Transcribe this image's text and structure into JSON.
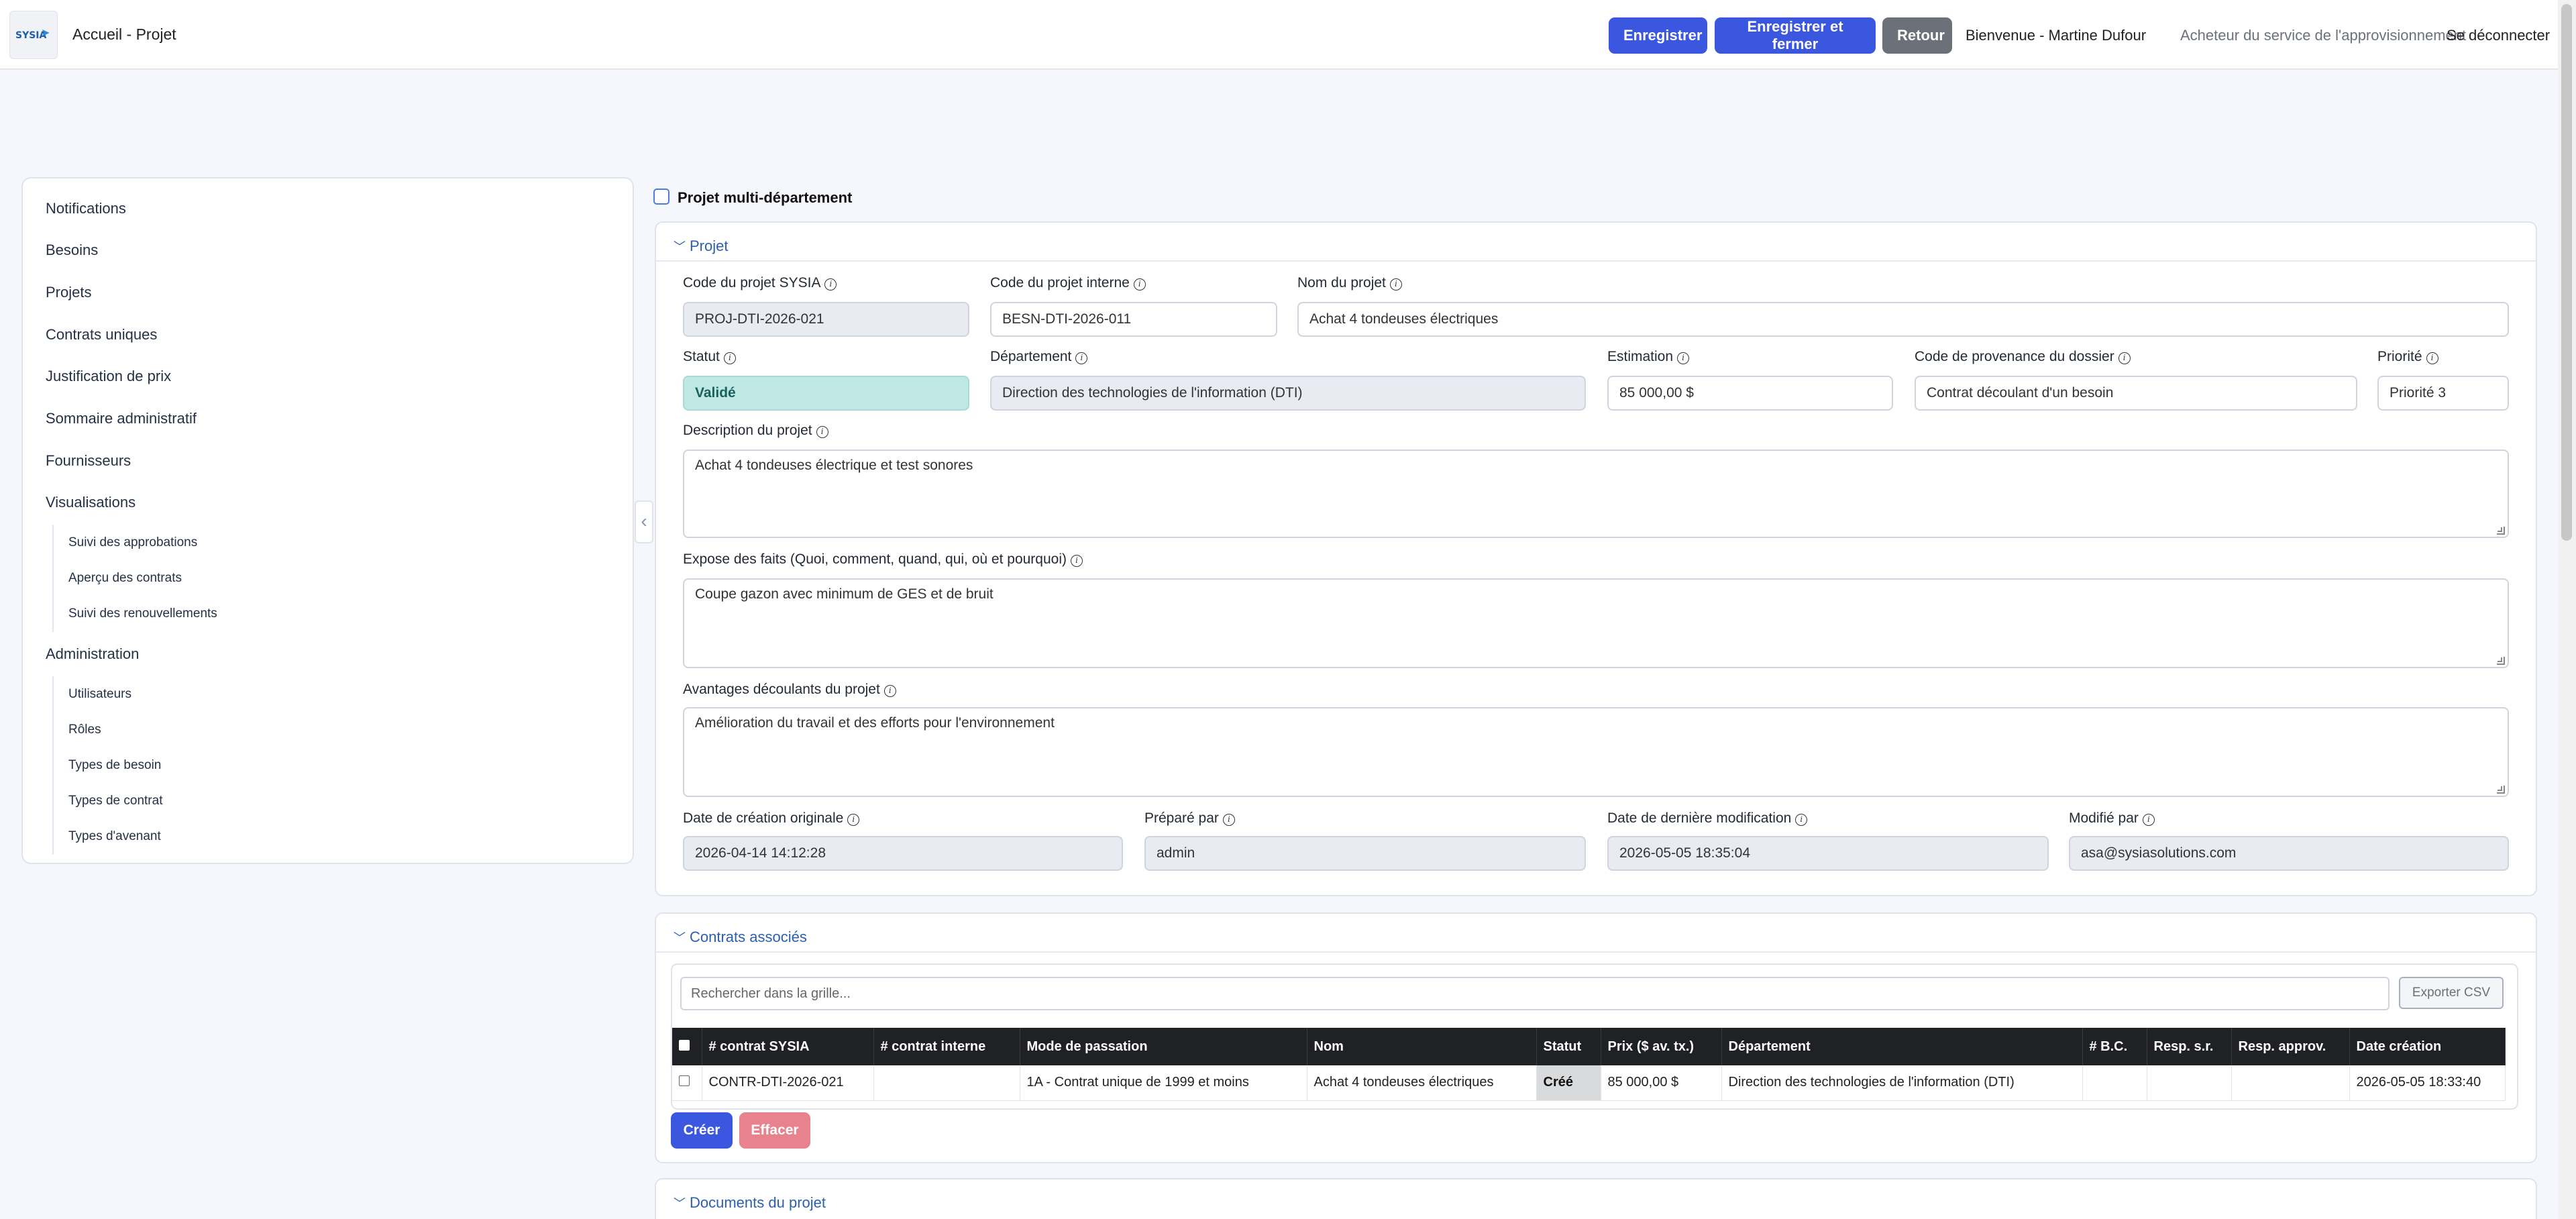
{
  "header": {
    "logo_text": "SYSIA",
    "breadcrumb": "Accueil  -  Projet",
    "save_label": "Enregistrer",
    "save_close_label": "Enregistrer et fermer",
    "back_label": "Retour",
    "welcome": "Bienvenue - Martine Dufour",
    "role": "Acheteur du service de l'approvisionnement",
    "logout": "Se déconnecter"
  },
  "sidebar": {
    "items": [
      {
        "label": "Notifications"
      },
      {
        "label": "Besoins"
      },
      {
        "label": "Projets"
      },
      {
        "label": "Contrats uniques"
      },
      {
        "label": "Justification de prix"
      },
      {
        "label": "Sommaire administratif"
      },
      {
        "label": "Fournisseurs"
      },
      {
        "label": "Visualisations"
      },
      {
        "label": "Administration"
      }
    ],
    "visualisations_sub": [
      {
        "label": "Suivi des approbations"
      },
      {
        "label": "Aperçu des contrats"
      },
      {
        "label": "Suivi des renouvellements"
      }
    ],
    "administration_sub": [
      {
        "label": "Utilisateurs"
      },
      {
        "label": "Rôles"
      },
      {
        "label": "Types de besoin"
      },
      {
        "label": "Types de contrat"
      },
      {
        "label": "Types d'avenant"
      }
    ]
  },
  "multi_department": {
    "label": "Projet multi-département",
    "checked": false
  },
  "project": {
    "section_title": "Projet",
    "sysia_code_label": "Code du projet SYSIA",
    "sysia_code": "PROJ-DTI-2026-021",
    "internal_code_label": "Code du projet interne",
    "internal_code": "BESN-DTI-2026-011",
    "name_label": "Nom du projet",
    "name": "Achat 4 tondeuses électriques",
    "status_label": "Statut",
    "status": "Validé",
    "department_label": "Département",
    "department": "Direction des technologies de l'information (DTI)",
    "estimate_label": "Estimation",
    "estimate": "85 000,00 $",
    "origin_label": "Code de provenance du dossier",
    "origin": "Contrat découlant d'un besoin",
    "priority_label": "Priorité",
    "priority": "Priorité 3",
    "description_label": "Description du projet",
    "description": "Achat 4 tondeuses électrique  et test sonores",
    "facts_label": "Expose des faits (Quoi, comment, quand, qui, où et pourquoi)",
    "facts": "Coupe gazon avec minimum de GES et de bruit",
    "benefits_label": "Avantages découlants du projet",
    "benefits": "Amélioration du travail et des efforts pour l'environnement",
    "created_label": "Date de création originale",
    "created": "2026-04-14 14:12:28",
    "prepared_label": "Préparé par",
    "prepared": "admin",
    "modified_date_label": "Date de dernière modification",
    "modified_date": "2026-05-05 18:35:04",
    "modified_by_label": "Modifié par",
    "modified_by": "asa@sysiasolutions.com"
  },
  "contracts": {
    "section_title": "Contrats associés",
    "search_placeholder": "Rechercher dans la grille...",
    "export_label": "Exporter CSV",
    "columns": [
      "# contrat SYSIA",
      "# contrat interne",
      "Mode de passation",
      "Nom",
      "Statut",
      "Prix ($ av. tx.)",
      "Département",
      "# B.C.",
      "Resp. s.r.",
      "Resp. approv.",
      "Date création"
    ],
    "rows": [
      [
        "CONTR-DTI-2026-021",
        "",
        "1A - Contrat unique de 1999 et moins",
        "Achat 4 tondeuses électriques",
        "Créé",
        "85 000,00 $",
        "Direction des technologies de l'information (DTI)",
        "",
        "",
        "",
        "2026-05-05 18:33:40"
      ]
    ],
    "create_label": "Créer",
    "clear_label": "Effacer"
  },
  "documents": {
    "section_title": "Documents du projet"
  },
  "colors": {
    "primary": "#3b57e0",
    "secondary": "#6c7179",
    "status_bg": "#bfe8e4",
    "link": "#2b5fb2"
  }
}
